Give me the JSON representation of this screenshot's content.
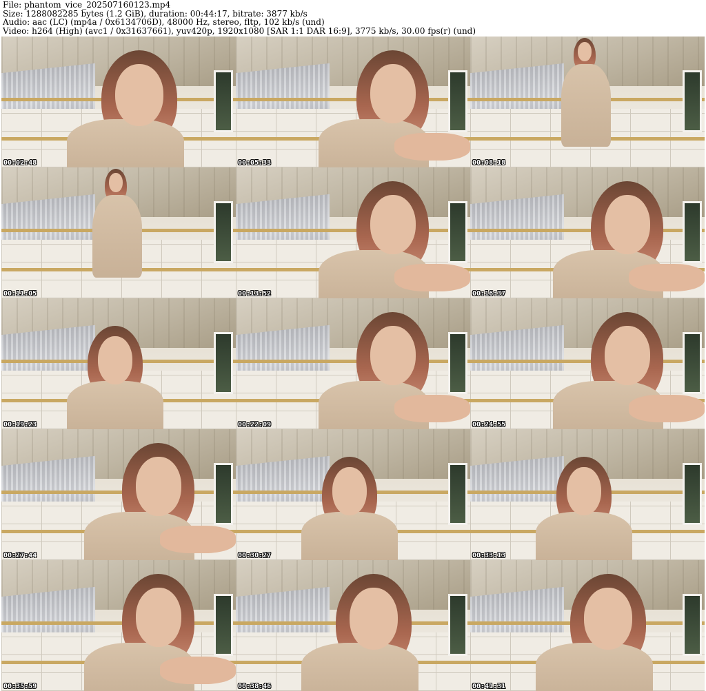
{
  "header": {
    "file_line": "File: phantom_vice_202507160123.mp4",
    "size_line": "Size: 1288082285 bytes (1.2 GiB), duration: 00:44:17, bitrate: 3877 kb/s",
    "audio_line": "Audio: aac (LC) (mp4a / 0x6134706D), 48000 Hz, stereo, fltp, 102 kb/s (und)",
    "video_line": "Video: h264 (High) (avc1 / 0x31637661), yuv420p, 1920x1080 [SAR 1:1 DAR 16:9], 3775 kb/s, 30.00 fps(r) (und)"
  },
  "thumbnails": [
    {
      "timestamp": "00:02:48",
      "pose": "close"
    },
    {
      "timestamp": "00:05:33",
      "pose": "close-hand"
    },
    {
      "timestamp": "00:08:18",
      "pose": "standing"
    },
    {
      "timestamp": "00:11:05",
      "pose": "standing"
    },
    {
      "timestamp": "00:13:52",
      "pose": "close-hand"
    },
    {
      "timestamp": "00:16:37",
      "pose": "close-hand"
    },
    {
      "timestamp": "00:19:23",
      "pose": "seated"
    },
    {
      "timestamp": "00:22:09",
      "pose": "close-hand"
    },
    {
      "timestamp": "00:24:55",
      "pose": "close-hand"
    },
    {
      "timestamp": "00:27:44",
      "pose": "close-hand"
    },
    {
      "timestamp": "00:30:27",
      "pose": "seated"
    },
    {
      "timestamp": "00:33:13",
      "pose": "seated"
    },
    {
      "timestamp": "00:35:59",
      "pose": "close-hand"
    },
    {
      "timestamp": "00:38:46",
      "pose": "close"
    },
    {
      "timestamp": "00:41:31",
      "pose": "close"
    }
  ],
  "colors": {
    "beam": "#c9a862",
    "dress": "#d8c3aa",
    "hair": "#a8664f"
  }
}
